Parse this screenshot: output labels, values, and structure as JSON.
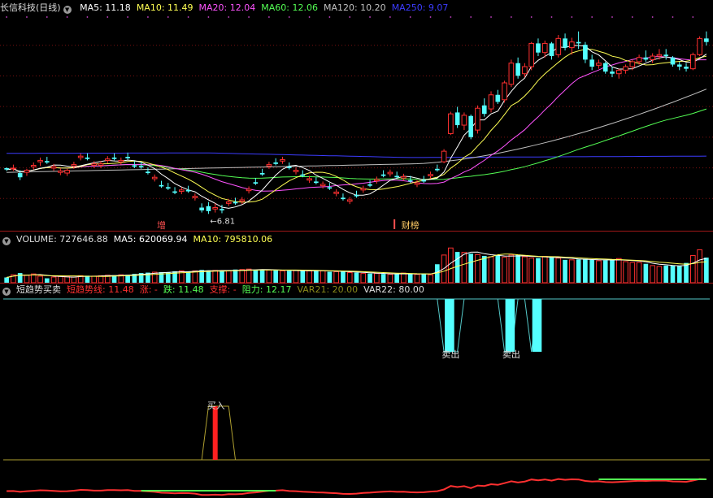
{
  "colors": {
    "up": "#ff3030",
    "down": "#54ffff",
    "ma5": "#ffffff",
    "ma10": "#ffff54",
    "ma20": "#ff54ff",
    "ma60": "#54ff54",
    "ma120": "#c0c0c0",
    "ma250": "#3c3cff",
    "grid": "#7a1010"
  },
  "price_panel": {
    "title": "长信科技(日线)",
    "collapse_icon": "chevron-down-icon",
    "indicators": [
      {
        "label": "MA5: 11.18",
        "color": "#ffffff"
      },
      {
        "label": "MA10: 11.49",
        "color": "#ffff54"
      },
      {
        "label": "MA20: 12.04",
        "color": "#ff54ff"
      },
      {
        "label": "MA60: 12.06",
        "color": "#54ff54"
      },
      {
        "label": "MA120: 10.20",
        "color": "#c0c0c0"
      },
      {
        "label": "MA250: 9.07",
        "color": "#3c3cff"
      }
    ],
    "low_marker": "6.81",
    "tag_left": "增",
    "tag_right": "财榜"
  },
  "volume_panel": {
    "indicators": [
      {
        "label": "VOLUME: 727646.88",
        "color": "#dddddd"
      },
      {
        "label": "MA5: 620069.94",
        "color": "#ffffff"
      },
      {
        "label": "MA10: 795810.06",
        "color": "#ffff54"
      }
    ]
  },
  "signal_panel": {
    "title": "短趋势买卖",
    "indicators": [
      {
        "label": "短趋势线: 11.48",
        "color": "#ff3030"
      },
      {
        "label": "涨: -",
        "color": "#ff3030"
      },
      {
        "label": "跌: 11.48",
        "color": "#54ff54"
      },
      {
        "label": "支撑: -",
        "color": "#ff3030"
      },
      {
        "label": "阻力: 12.17",
        "color": "#54ff54"
      },
      {
        "label": "VAR21: 20.00",
        "color": "#8a8a1a"
      },
      {
        "label": "VAR22: 80.00",
        "color": "#dddddd"
      }
    ],
    "buy_label": "买入",
    "sell_labels": [
      "卖出",
      "卖出"
    ]
  },
  "chart_data": {
    "type": "candlestick",
    "bars": 105,
    "ohlc": [
      [
        7.51,
        7.52,
        7.47,
        7.49
      ],
      [
        7.5,
        7.56,
        7.47,
        7.51
      ],
      [
        7.44,
        7.48,
        7.34,
        7.38
      ],
      [
        7.45,
        7.5,
        7.4,
        7.48
      ],
      [
        7.53,
        7.59,
        7.49,
        7.55
      ],
      [
        7.6,
        7.66,
        7.54,
        7.62
      ],
      [
        7.61,
        7.67,
        7.57,
        7.59
      ],
      [
        7.51,
        7.57,
        7.47,
        7.53
      ],
      [
        7.45,
        7.51,
        7.41,
        7.47
      ],
      [
        7.44,
        7.5,
        7.4,
        7.48
      ],
      [
        7.54,
        7.6,
        7.5,
        7.56
      ],
      [
        7.66,
        7.72,
        7.62,
        7.68
      ],
      [
        7.66,
        7.72,
        7.62,
        7.64
      ],
      [
        7.55,
        7.61,
        7.51,
        7.57
      ],
      [
        7.55,
        7.61,
        7.51,
        7.57
      ],
      [
        7.62,
        7.68,
        7.58,
        7.64
      ],
      [
        7.66,
        7.72,
        7.62,
        7.64
      ],
      [
        7.6,
        7.66,
        7.56,
        7.62
      ],
      [
        7.67,
        7.73,
        7.63,
        7.65
      ],
      [
        7.55,
        7.61,
        7.51,
        7.53
      ],
      [
        7.54,
        7.6,
        7.5,
        7.52
      ],
      [
        7.46,
        7.52,
        7.42,
        7.44
      ],
      [
        7.36,
        7.42,
        7.32,
        7.38
      ],
      [
        7.27,
        7.33,
        7.23,
        7.25
      ],
      [
        7.24,
        7.3,
        7.2,
        7.22
      ],
      [
        7.18,
        7.24,
        7.14,
        7.16
      ],
      [
        7.18,
        7.24,
        7.14,
        7.2
      ],
      [
        7.2,
        7.26,
        7.16,
        7.18
      ],
      [
        7.09,
        7.15,
        7.05,
        7.11
      ],
      [
        6.95,
        7.01,
        6.88,
        6.91
      ],
      [
        6.97,
        7.03,
        6.86,
        6.9
      ],
      [
        6.93,
        7.01,
        6.88,
        6.95
      ],
      [
        6.93,
        6.99,
        6.87,
        6.91
      ],
      [
        7.01,
        7.07,
        6.97,
        7.03
      ],
      [
        7.03,
        7.09,
        6.99,
        7.01
      ],
      [
        7.04,
        7.1,
        7.0,
        7.06
      ],
      [
        7.19,
        7.25,
        7.15,
        7.21
      ],
      [
        7.31,
        7.37,
        7.27,
        7.29
      ],
      [
        7.44,
        7.5,
        7.4,
        7.42
      ],
      [
        7.54,
        7.6,
        7.5,
        7.56
      ],
      [
        7.59,
        7.65,
        7.55,
        7.57
      ],
      [
        7.61,
        7.67,
        7.57,
        7.63
      ],
      [
        7.53,
        7.59,
        7.49,
        7.51
      ],
      [
        7.46,
        7.52,
        7.42,
        7.48
      ],
      [
        7.42,
        7.48,
        7.38,
        7.4
      ],
      [
        7.34,
        7.4,
        7.3,
        7.36
      ],
      [
        7.32,
        7.38,
        7.28,
        7.3
      ],
      [
        7.26,
        7.32,
        7.22,
        7.28
      ],
      [
        7.24,
        7.3,
        7.2,
        7.22
      ],
      [
        7.15,
        7.21,
        7.11,
        7.17
      ],
      [
        7.09,
        7.15,
        7.05,
        7.07
      ],
      [
        7.04,
        7.1,
        7.0,
        7.06
      ],
      [
        7.13,
        7.19,
        7.09,
        7.11
      ],
      [
        7.2,
        7.26,
        7.16,
        7.22
      ],
      [
        7.28,
        7.34,
        7.24,
        7.26
      ],
      [
        7.33,
        7.39,
        7.29,
        7.35
      ],
      [
        7.42,
        7.48,
        7.38,
        7.4
      ],
      [
        7.43,
        7.49,
        7.39,
        7.45
      ],
      [
        7.4,
        7.46,
        7.36,
        7.38
      ],
      [
        7.37,
        7.43,
        7.33,
        7.39
      ],
      [
        7.34,
        7.4,
        7.3,
        7.32
      ],
      [
        7.28,
        7.34,
        7.24,
        7.3
      ],
      [
        7.34,
        7.4,
        7.3,
        7.32
      ],
      [
        7.4,
        7.46,
        7.36,
        7.42
      ],
      [
        7.5,
        7.56,
        7.46,
        7.48
      ],
      [
        7.6,
        7.78,
        7.58,
        7.75
      ],
      [
        8.0,
        8.31,
        7.98,
        8.28
      ],
      [
        8.3,
        8.38,
        8.08,
        8.12
      ],
      [
        8.12,
        8.3,
        8.05,
        8.26
      ],
      [
        8.25,
        8.27,
        7.92,
        7.95
      ],
      [
        8.05,
        8.4,
        8.0,
        8.36
      ],
      [
        8.4,
        8.5,
        8.24,
        8.28
      ],
      [
        8.35,
        8.6,
        8.3,
        8.55
      ],
      [
        8.55,
        8.62,
        8.42,
        8.45
      ],
      [
        8.48,
        8.75,
        8.44,
        8.72
      ],
      [
        8.7,
        9.05,
        8.66,
        9.0
      ],
      [
        9.0,
        9.08,
        8.78,
        8.82
      ],
      [
        8.85,
        9.0,
        8.8,
        8.95
      ],
      [
        8.95,
        9.3,
        8.9,
        9.28
      ],
      [
        9.28,
        9.35,
        9.1,
        9.15
      ],
      [
        9.15,
        9.32,
        9.08,
        9.28
      ],
      [
        9.28,
        9.3,
        9.05,
        9.1
      ],
      [
        9.12,
        9.4,
        9.08,
        9.35
      ],
      [
        9.35,
        9.42,
        9.18,
        9.22
      ],
      [
        9.22,
        9.36,
        9.12,
        9.3
      ],
      [
        9.3,
        9.45,
        9.2,
        9.28
      ],
      [
        9.26,
        9.3,
        9.0,
        9.05
      ],
      [
        9.05,
        9.12,
        8.9,
        8.95
      ],
      [
        8.97,
        9.05,
        8.92,
        9.0
      ],
      [
        9.0,
        9.02,
        8.85,
        8.88
      ],
      [
        8.88,
        8.95,
        8.8,
        8.85
      ],
      [
        8.85,
        8.92,
        8.78,
        8.9
      ],
      [
        8.9,
        8.98,
        8.85,
        8.95
      ],
      [
        8.95,
        9.05,
        8.9,
        9.02
      ],
      [
        9.02,
        9.12,
        8.98,
        9.08
      ],
      [
        9.08,
        9.18,
        9.02,
        9.05
      ],
      [
        9.05,
        9.14,
        9.0,
        9.1
      ],
      [
        9.1,
        9.2,
        9.05,
        9.12
      ],
      [
        9.12,
        9.2,
        9.05,
        9.1
      ],
      [
        9.08,
        9.1,
        8.95,
        8.98
      ],
      [
        8.98,
        9.02,
        8.9,
        8.95
      ],
      [
        8.95,
        9.0,
        8.88,
        8.92
      ],
      [
        8.92,
        9.15,
        8.9,
        9.12
      ],
      [
        9.12,
        9.38,
        9.1,
        9.35
      ],
      [
        9.35,
        9.45,
        9.25,
        9.3
      ]
    ],
    "volume": [
      0.12,
      0.18,
      0.22,
      0.17,
      0.2,
      0.15,
      0.1,
      0.13,
      0.14,
      0.14,
      0.13,
      0.16,
      0.16,
      0.15,
      0.16,
      0.17,
      0.17,
      0.18,
      0.18,
      0.2,
      0.22,
      0.23,
      0.24,
      0.24,
      0.24,
      0.26,
      0.27,
      0.25,
      0.27,
      0.29,
      0.28,
      0.28,
      0.27,
      0.27,
      0.3,
      0.3,
      0.31,
      0.29,
      0.3,
      0.29,
      0.28,
      0.27,
      0.27,
      0.28,
      0.28,
      0.27,
      0.27,
      0.27,
      0.25,
      0.25,
      0.25,
      0.23,
      0.23,
      0.21,
      0.21,
      0.21,
      0.2,
      0.19,
      0.2,
      0.22,
      0.2,
      0.19,
      0.2,
      0.18,
      0.42,
      0.63,
      0.79,
      0.7,
      0.69,
      0.66,
      0.64,
      0.61,
      0.59,
      0.62,
      0.58,
      0.63,
      0.63,
      0.59,
      0.56,
      0.56,
      0.6,
      0.58,
      0.56,
      0.52,
      0.52,
      0.53,
      0.54,
      0.52,
      0.5,
      0.51,
      0.52,
      0.55,
      0.48,
      0.46,
      0.46,
      0.43,
      0.39,
      0.37,
      0.39,
      0.39,
      0.38,
      0.45,
      0.62,
      0.75,
      0.57
    ],
    "buy_zone": {
      "start": 29,
      "end": 34
    },
    "sell_zones": [
      {
        "start": 64,
        "end": 68
      },
      {
        "start": 73,
        "end": 76
      },
      {
        "start": 77,
        "end": 79
      }
    ],
    "low": 6.81
  }
}
